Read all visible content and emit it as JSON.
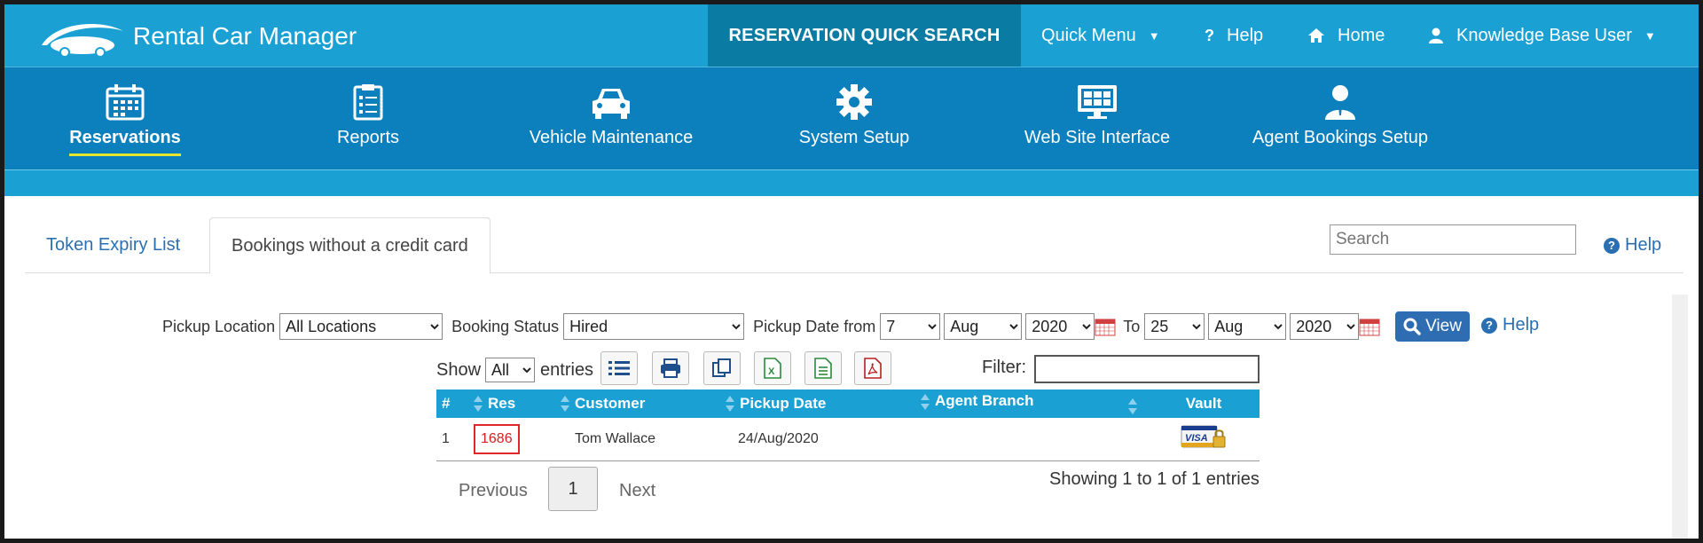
{
  "header": {
    "app_title": "Rental Car Manager",
    "quick_search": "RESERVATION QUICK SEARCH",
    "quick_menu": "Quick Menu",
    "help": "Help",
    "home": "Home",
    "user": "Knowledge Base User"
  },
  "nav": {
    "items": [
      {
        "label": "Reservations",
        "icon": "calendar-icon"
      },
      {
        "label": "Reports",
        "icon": "clipboard-list-icon"
      },
      {
        "label": "Vehicle Maintenance",
        "icon": "car-icon"
      },
      {
        "label": "System Setup",
        "icon": "gear-icon"
      },
      {
        "label": "Web Site Interface",
        "icon": "monitor-icon"
      },
      {
        "label": "Agent Bookings Setup",
        "icon": "agent-user-icon"
      }
    ],
    "active": "Reservations"
  },
  "tabs": {
    "items": [
      "Token Expiry List",
      "Bookings without a credit card"
    ],
    "active": "Bookings without a credit card"
  },
  "search": {
    "placeholder": "Search"
  },
  "help_link": "Help",
  "filters": {
    "pickup_location_label": "Pickup Location",
    "pickup_location_value": "All Locations",
    "booking_status_label": "Booking Status",
    "booking_status_value": "Hired",
    "pickup_date_from_label": "Pickup Date from",
    "from_day": "7",
    "from_month": "Aug",
    "from_year": "2020",
    "to_label": "To",
    "to_day": "25",
    "to_month": "Aug",
    "to_year": "2020",
    "view_button": "View",
    "help_label": "Help"
  },
  "entries": {
    "show_label": "Show",
    "show_value": "All",
    "entries_label": "entries",
    "filter_label": "Filter:"
  },
  "table": {
    "headers": [
      "#",
      "Res",
      "Customer",
      "Pickup Date",
      "Agent Branch",
      "Vault"
    ],
    "rows": [
      {
        "num": "1",
        "res": "1686",
        "customer": "Tom Wallace",
        "pickup_date": "24/Aug/2020",
        "agent_branch": "",
        "vault": "VISA"
      }
    ]
  },
  "pagination": {
    "previous": "Previous",
    "page": "1",
    "next": "Next",
    "summary": "Showing 1 to 1 of 1 entries"
  },
  "colors": {
    "topbar": "#1aa0d2",
    "quick_search_bg": "#0a7ba3",
    "mainnav": "#0c7fbd",
    "link": "#2a6fb2",
    "active_underline": "#e6e62e",
    "highlight_border": "#e02828"
  }
}
